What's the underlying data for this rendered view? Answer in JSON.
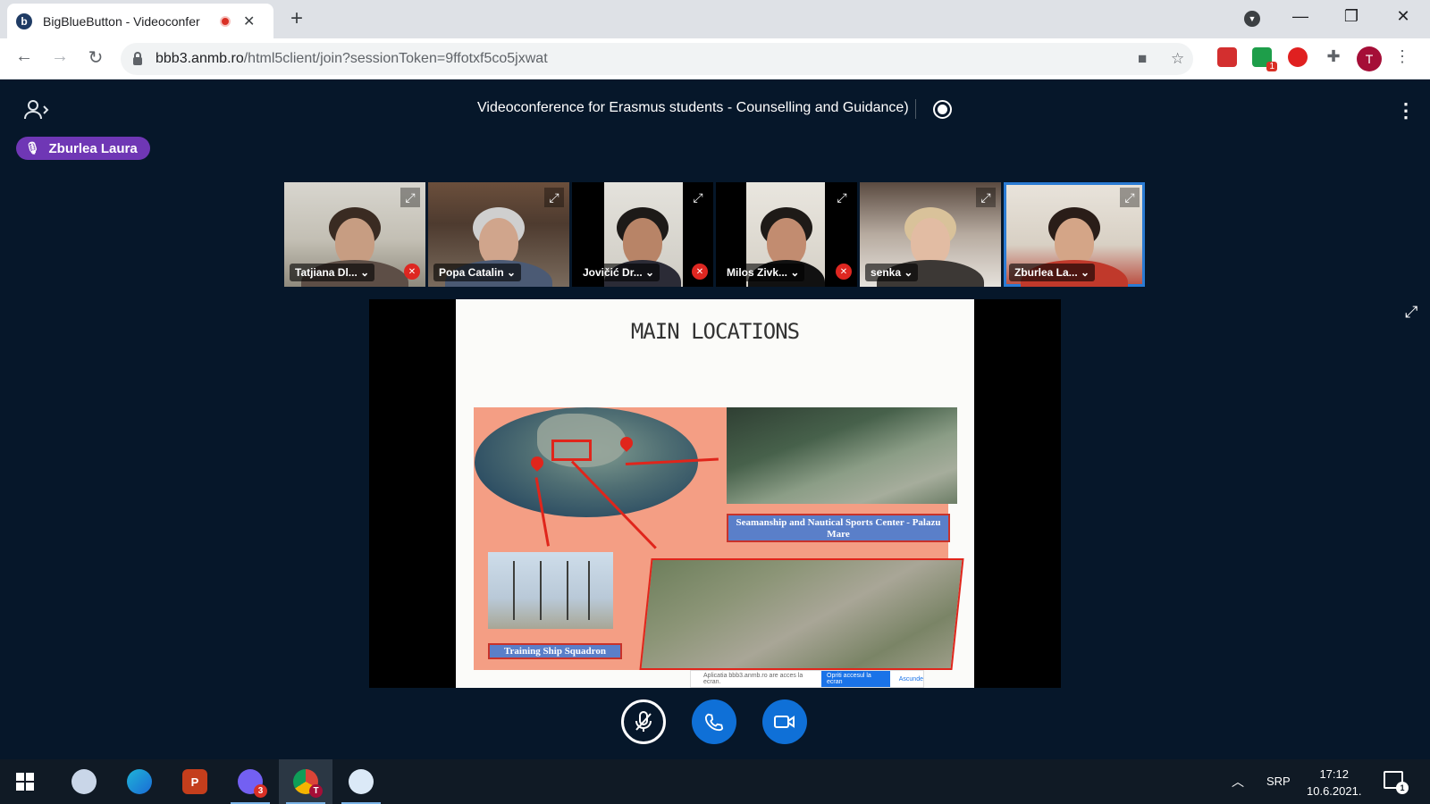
{
  "browser": {
    "tab": {
      "favicon": "b",
      "title": "BigBlueButton - Videoconfer",
      "close": "✕"
    },
    "new_tab": "+",
    "url_host": "bbb3.anmb.ro",
    "url_path": "/html5client/join?sessionToken=9ffotxf5co5jxwat",
    "profile_initial": "T",
    "extension_badge": "1",
    "window": {
      "minimize": "—",
      "restore": "❐",
      "close": "✕"
    }
  },
  "meeting": {
    "title": "Videoconference for Erasmus students - Counselling and Guidance)",
    "talking_indicator": "Zburlea Laura"
  },
  "participants": [
    {
      "name": "Tatjiana Dl...",
      "muted": true,
      "caret": "⌄"
    },
    {
      "name": "Popa Catalin",
      "muted": false,
      "caret": "⌄"
    },
    {
      "name": "Jovičić Dr...",
      "muted": true,
      "caret": "⌄"
    },
    {
      "name": "Milos Zivk...",
      "muted": true,
      "caret": "⌄"
    },
    {
      "name": "senka",
      "muted": false,
      "caret": "⌄"
    },
    {
      "name": "Zburlea La...",
      "muted": false,
      "caret": "⌄",
      "active": true
    }
  ],
  "slide": {
    "title": "MAIN LOCATIONS",
    "label_top_right": "Seamanship and Nautical Sports Center - Palazu Mare",
    "label_bottom_left": "Training Ship Squadron",
    "screen_share_notice": "Aplicatia bbb3.anmb.ro are acces la ecran.",
    "screen_share_stop": "Opriti accesul la ecran",
    "screen_share_cancel": "Ascunde"
  },
  "taskbar": {
    "language": "SRP",
    "time": "17:12",
    "date": "10.6.2021.",
    "viber_badge": "3",
    "chrome_initial": "T",
    "notification_count": "1"
  },
  "colors": {
    "app_background": "#06172a",
    "talking_badge": "#6f37b5",
    "action_blue": "#0f70d7",
    "slide_salmon": "#f49e84",
    "slide_label": "#5a7fc9"
  }
}
